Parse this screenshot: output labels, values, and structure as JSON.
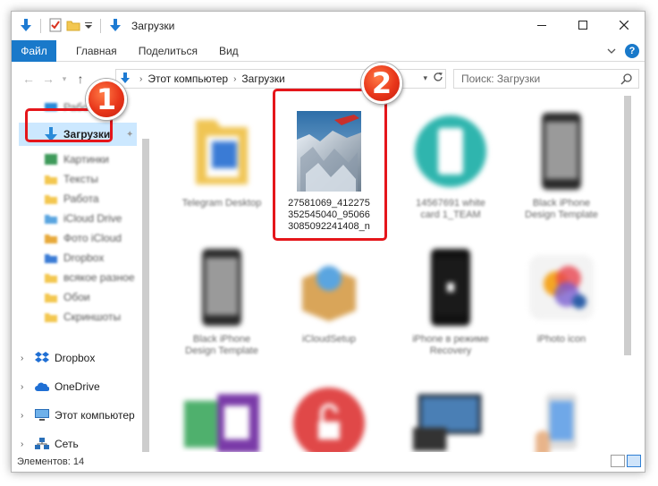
{
  "window": {
    "title": "Загрузки"
  },
  "ribbon": {
    "file_tab": "Файл",
    "tabs": [
      "Главная",
      "Поделиться",
      "Вид"
    ]
  },
  "address": {
    "crumbs": [
      "Этот компьютер",
      "Загрузки"
    ],
    "search_placeholder": "Поиск: Загрузки"
  },
  "navpane": {
    "partial_top": "Рабоч",
    "selected": "Загрузки",
    "blurred_items": [
      "Картинки",
      "Тексты",
      "Работа",
      "iCloud Drive",
      "Фото iCloud",
      "Dropbox",
      "всякое разное",
      "Обои",
      "Скриншоты"
    ],
    "roots": [
      "Dropbox",
      "OneDrive",
      "Этот компьютер",
      "Сеть"
    ]
  },
  "content": {
    "tiles": [
      {
        "caption": "Telegram Desktop",
        "kind": "folder"
      },
      {
        "caption": "27581069_412275352545040_950663085092241408_n",
        "kind": "photo",
        "lines": [
          "27581069_412275",
          "352545040_95066",
          "3085092241408_n"
        ]
      },
      {
        "caption": "14567691 white card 1_TEAM",
        "kind": "teal-circle"
      },
      {
        "caption": "Black iPhone Design Template",
        "kind": "iphone"
      },
      {
        "caption": "Black iPhone Design Template",
        "kind": "iphone"
      },
      {
        "caption": "iCloudSetup",
        "kind": "box"
      },
      {
        "caption": "iPhone в режиме Recovery",
        "kind": "iphone-dark"
      },
      {
        "caption": "iPhoto icon",
        "kind": "photos-icon"
      },
      {
        "caption": "",
        "kind": "onenote"
      },
      {
        "caption": "",
        "kind": "unlock"
      },
      {
        "caption": "",
        "kind": "devices"
      },
      {
        "caption": "",
        "kind": "hand-phone"
      }
    ]
  },
  "status": {
    "items_count": "Элементов: 14"
  },
  "callouts": {
    "badge1": "1",
    "badge2": "2"
  },
  "colors": {
    "accent": "#1979ca",
    "callout_red": "#e5161b",
    "selection": "#cce8ff"
  }
}
